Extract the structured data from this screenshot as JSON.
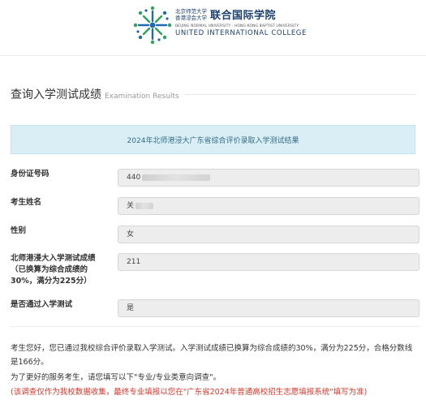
{
  "header": {
    "logo_cn_line1": "北京师范大学",
    "logo_cn_line2": "香港浸会大学",
    "logo_cn_big": "联合国际学院",
    "logo_en_small": "BEIJING NORMAL UNIVERSITY · HONG KONG BAPTIST UNIVERSITY",
    "logo_en_big": "UNITED INTERNATIONAL COLLEGE"
  },
  "section": {
    "title_cn": "查询入学测试成绩",
    "title_en": "Examination Results"
  },
  "alert": "2024年北师港浸大广东省综合评价录取入学测试结果",
  "fields": [
    {
      "label": "身份证号码",
      "value": "440"
    },
    {
      "label": "考生姓名",
      "value": "关"
    },
    {
      "label": "性别",
      "value": "女"
    },
    {
      "label": "北师港浸大入学测试成绩（已换算为综合成绩的30%，满分为225分）",
      "value": "211"
    },
    {
      "label": "是否通过入学测试",
      "value": "是"
    }
  ],
  "notes": {
    "line1": "考生您好，您已通过我校综合评价录取入学测试。入学测试成绩已换算为综合成绩的30%，满分为225分，合格分数线是166分。",
    "line2": "为了更好的服务考生，请您填写以下\"专业/专业类意向调查\"。",
    "line3": "(该调查仅作为我校数据收集，最终专业填报以您在\"广东省2024年普通高校招生志愿填报系统\"填写为准)"
  },
  "colors": {
    "brand": "#1a3f6f",
    "logo_green": "#2ba35a",
    "logo_blue": "#1e6ab3",
    "alert_bg": "#d9eef5",
    "alert_text": "#356d87",
    "warning_text": "#d9352a"
  }
}
